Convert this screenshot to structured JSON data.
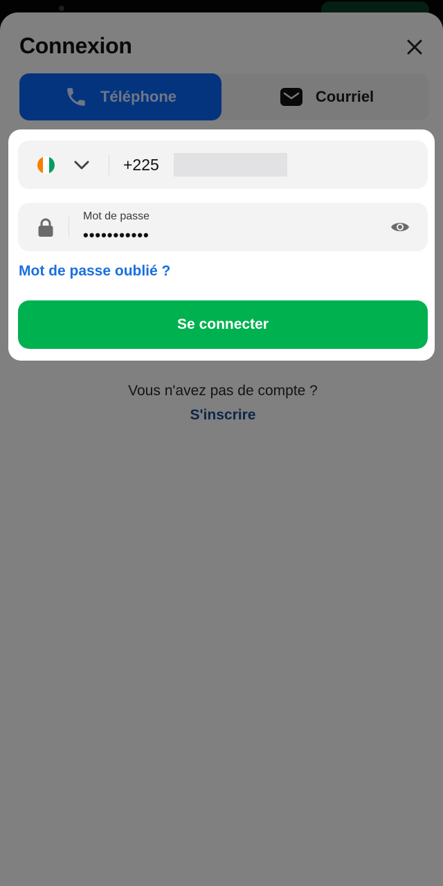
{
  "header": {
    "title": "Connexion",
    "close_icon": "close-icon"
  },
  "tabs": [
    {
      "label": "Téléphone",
      "icon": "phone-icon",
      "active": true
    },
    {
      "label": "Courriel",
      "icon": "envelope-icon",
      "active": false
    }
  ],
  "phone_field": {
    "country_flag": "cote-divoire-flag",
    "country_code": "+225",
    "dropdown_icon": "chevron-down-icon"
  },
  "password_field": {
    "label": "Mot de passe",
    "value": "•••••••••••",
    "lock_icon": "lock-icon",
    "toggle_icon": "eye-icon"
  },
  "forgot_password": "Mot de passe oublié ?",
  "submit_label": "Se connecter",
  "signup_prompt": "Vous n'avez pas de compte ?",
  "signup_link": "S'inscrire",
  "colors": {
    "primary_blue": "#0a62f0",
    "link_blue": "#1a6fe0",
    "submit_green": "#00b14f"
  }
}
